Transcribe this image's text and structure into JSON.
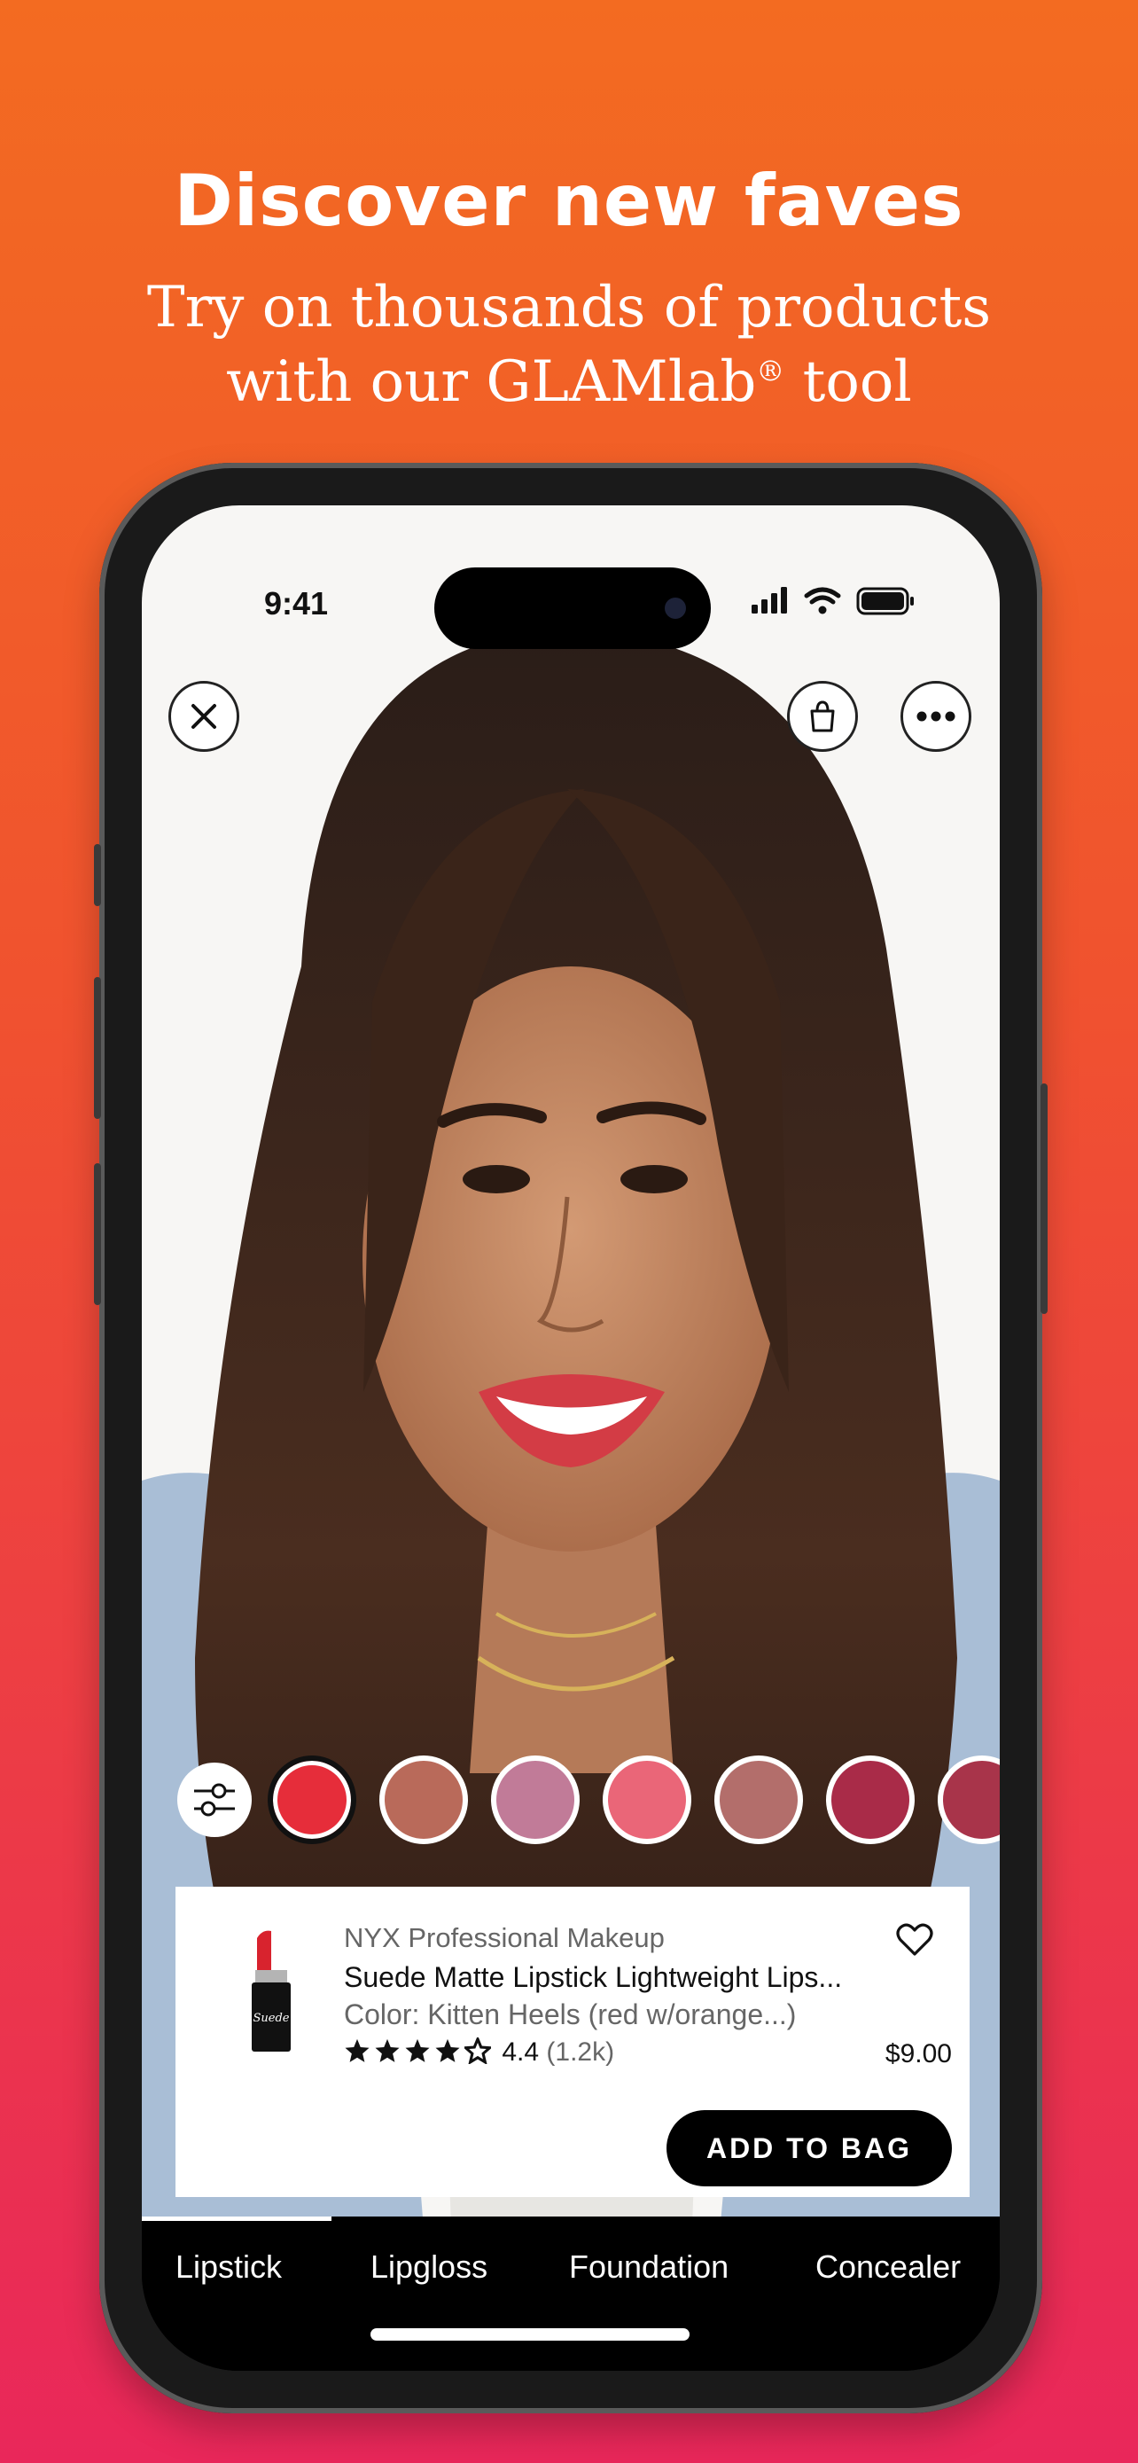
{
  "headline": "Discover new faves",
  "subline": {
    "line1": "Try on thousands of products",
    "line2_prefix": "with our GLAMlab",
    "line2_sup": "®",
    "line2_suffix": " tool"
  },
  "status_bar": {
    "time": "9:41"
  },
  "toolbar": {
    "close_icon": "close-icon",
    "bag_icon": "shopping-bag-icon",
    "more_icon": "more-icon"
  },
  "swatches": {
    "filter_icon": "sliders-icon",
    "colors": [
      "#e62d3a",
      "#b96a5a",
      "#c17b98",
      "#ea6678",
      "#b36e6b",
      "#a92b48",
      "#a8344a"
    ],
    "selected_index": 0
  },
  "product": {
    "brand": "NYX Professional Makeup",
    "name": "Suede Matte Lipstick Lightweight Lips...",
    "color": "Color: Kitten Heels (red w/orange...)",
    "stars": 4.5,
    "rating": "4.4",
    "review_count": "(1.2k)",
    "price": "$9.00",
    "add_to_bag": "ADD TO BAG",
    "heart_icon": "heart-icon",
    "image_label": "Suede"
  },
  "tabs": [
    "Lipstick",
    "Lipgloss",
    "Foundation",
    "Concealer"
  ],
  "active_tab_index": 0,
  "colors": {
    "accent_top": "#f36b21",
    "accent_bottom": "#e9275a"
  }
}
